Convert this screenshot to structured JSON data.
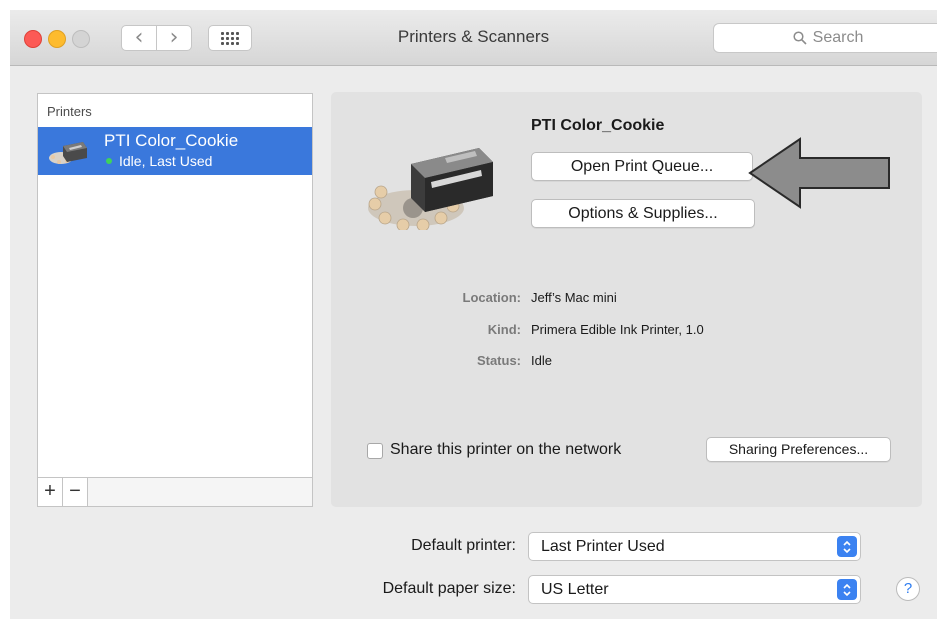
{
  "window": {
    "title": "Printers & Scanners"
  },
  "search": {
    "placeholder": "Search"
  },
  "printers": {
    "header": "Printers",
    "items": [
      {
        "name": "PTI Color_Cookie",
        "status": "Idle, Last Used"
      }
    ],
    "add_label": "+",
    "remove_label": "−"
  },
  "detail": {
    "printer_name": "PTI Color_Cookie",
    "open_queue_label": "Open Print Queue...",
    "options_label": "Options & Supplies...",
    "location_label": "Location:",
    "location_value": "Jeff’s Mac mini",
    "kind_label": "Kind:",
    "kind_value": "Primera Edible Ink Printer, 1.0",
    "status_label": "Status:",
    "status_value": "Idle",
    "share_label": "Share this printer on the network",
    "share_checked": false,
    "sharing_prefs_label": "Sharing Preferences..."
  },
  "defaults": {
    "printer_label": "Default printer:",
    "printer_value": "Last Printer Used",
    "paper_label": "Default paper size:",
    "paper_value": "US Letter"
  },
  "help": {
    "label": "?"
  },
  "colors": {
    "selection": "#3a78dc",
    "status_dot": "#3fd35a",
    "select_stepper": "#3b82f1",
    "arrow": "#8c8c8c"
  }
}
